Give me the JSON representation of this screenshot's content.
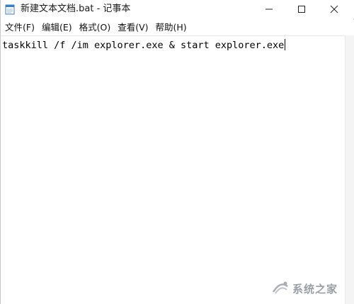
{
  "window": {
    "title": "新建文本文档.bat - 记事本"
  },
  "menubar": {
    "items": [
      {
        "label": "文件(F)"
      },
      {
        "label": "编辑(E)"
      },
      {
        "label": "格式(O)"
      },
      {
        "label": "查看(V)"
      },
      {
        "label": "帮助(H)"
      }
    ]
  },
  "editor": {
    "content": "taskkill /f /im explorer.exe & start explorer.exe"
  },
  "watermark": {
    "text": "系统之家"
  },
  "colors": {
    "background": "#ffffff",
    "text": "#000000",
    "watermark": "#8a8f96"
  },
  "icons": {
    "app": "notepad-icon",
    "minimize": "minimize-icon",
    "maximize": "maximize-icon",
    "close": "close-icon"
  }
}
